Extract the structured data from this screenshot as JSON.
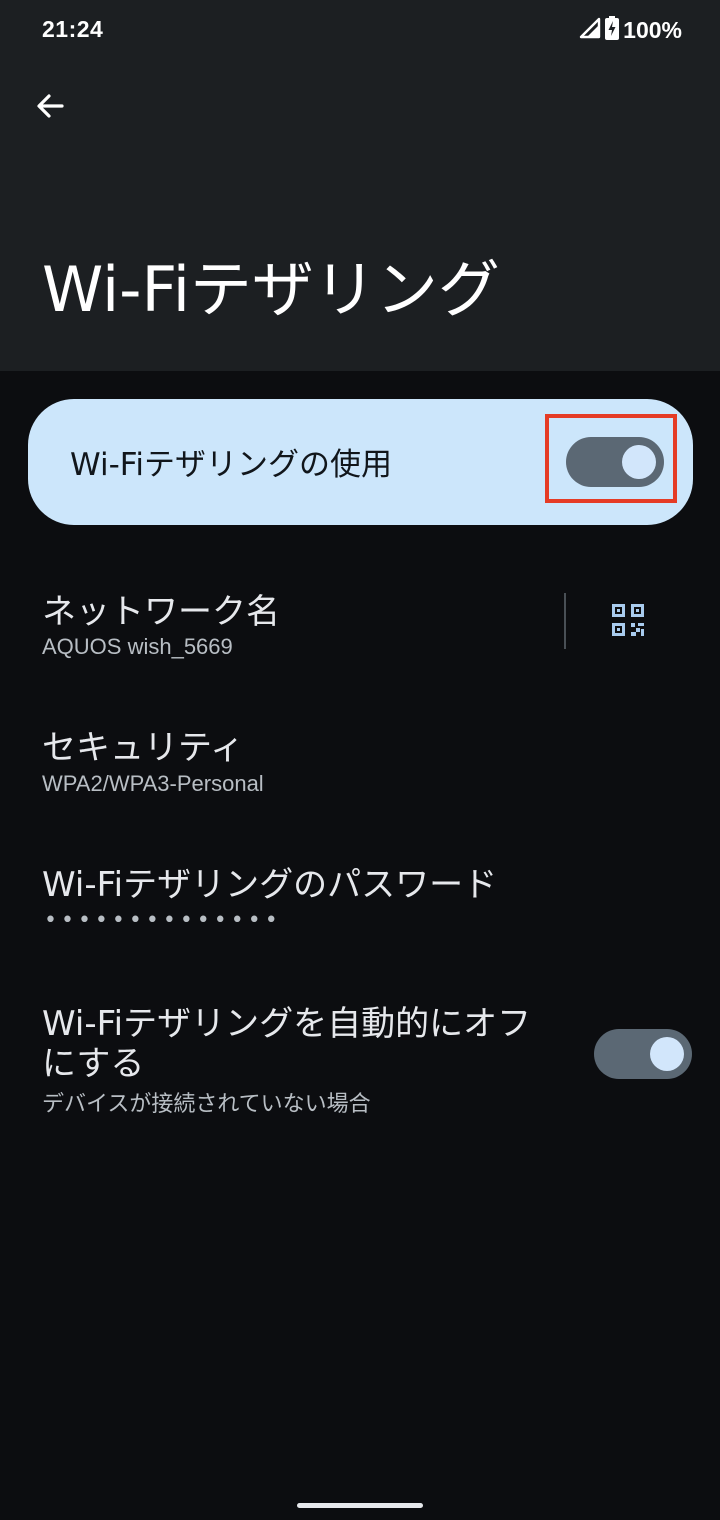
{
  "status_bar": {
    "time": "21:24",
    "battery_percent": "100%",
    "icons": [
      "signal-icon",
      "battery-charging-icon"
    ]
  },
  "app_bar": {
    "back_icon": "arrow-back-icon",
    "title": "Wi-Fiテザリング"
  },
  "main_switch": {
    "label": "Wi-Fiテザリングの使用",
    "on": true
  },
  "settings": {
    "network_name": {
      "title": "ネットワーク名",
      "value": "AQUOS wish_5669",
      "action_icon": "qr-code-icon"
    },
    "security": {
      "title": "セキュリティ",
      "value": "WPA2/WPA3-Personal"
    },
    "password": {
      "title": "Wi-Fiテザリングのパスワード",
      "masked_value": "••••••••••••••"
    },
    "auto_off": {
      "title_line1": "Wi-Fiテザリングを自動的にオフ",
      "title_line2": "にする",
      "summary": "デバイスが接続されていない場合",
      "on": true
    }
  },
  "colors": {
    "header_bg": "#1c1f22",
    "page_bg": "#0c0d10",
    "card_bg": "#cce6fb",
    "toggle_track": "#5b6874",
    "toggle_knob": "#d2e6fb",
    "highlight": "#e53b25"
  }
}
